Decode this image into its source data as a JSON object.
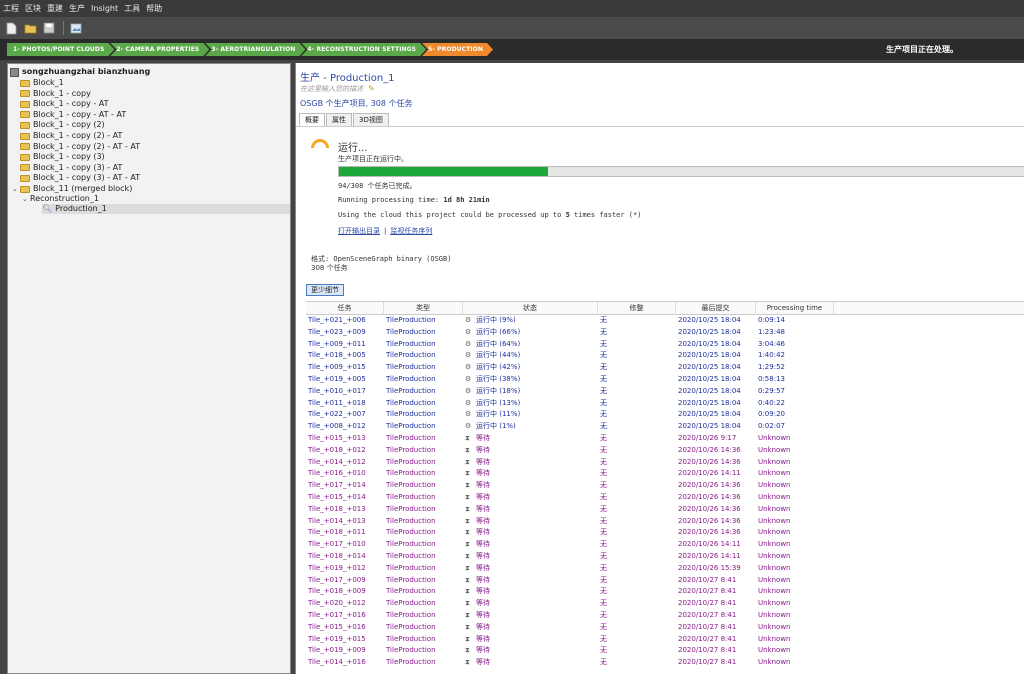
{
  "menu": [
    "工程",
    "区块",
    "重建",
    "生产",
    "Insight",
    "工具",
    "帮助"
  ],
  "toolbar": {
    "icons": [
      "new-file-icon",
      "open-folder-icon",
      "save-icon",
      "screenshot-icon"
    ]
  },
  "workflow": {
    "steps": [
      {
        "label": "1- PHOTOS/POINT CLOUDS",
        "color": "#5aa84a"
      },
      {
        "label": "2- CAMERA PROPERTIES",
        "color": "#5aa84a"
      },
      {
        "label": "3- AEROTRIANGULATION",
        "color": "#5aa84a"
      },
      {
        "label": "4- RECONSTRUCTION SETTINGS",
        "color": "#5aa84a"
      },
      {
        "label": "5- PRODUCTION",
        "color": "#ef8a2c"
      }
    ],
    "status": "生产项目正在处理。"
  },
  "tree": {
    "project": "songzhuangzhai bianzhuang",
    "blocks": [
      "Block_1",
      "Block_1 - copy",
      "Block_1 - copy - AT",
      "Block_1 - copy - AT - AT",
      "Block_1 - copy (2)",
      "Block_1 - copy (2) - AT",
      "Block_1 - copy (2) - AT - AT",
      "Block_1 - copy (3)",
      "Block_1 - copy (3) - AT",
      "Block_1 - copy (3) - AT - AT",
      "Block_11 (merged block)"
    ],
    "reconstruction": "Reconstruction_1",
    "production": "Production_1"
  },
  "main": {
    "title": "生产 - Production_1",
    "description_placeholder": "在这里输入您的描述",
    "subtitle": "OSGB 个生产项目, 308 个任务",
    "tabs": [
      "概要",
      "属性",
      "3D视图"
    ],
    "running_heading": "运行...",
    "running_sub": "生产项目正在运行中。",
    "progress": 0.3052,
    "done_text": "94/308 个任务已完成。",
    "runtime_label": "Running processing time:",
    "runtime_value": "1d 8h 21min",
    "cloud_text_prefix": "Using the cloud this project could be processed up to ",
    "cloud_text_bold": "5",
    "cloud_text_suffix": " times faster (*)",
    "link_open": "打开输出目录",
    "link_sep": "|",
    "link_monitor": "监视任务序列",
    "format_line": "格式: OpenSceneGraph binary (OSGB)",
    "task_count": "308 个任务",
    "less_button": "更少细节"
  },
  "table": {
    "headers": [
      "任务",
      "类型",
      "状态",
      "修整",
      "最后提交",
      "Processing time"
    ],
    "rows": [
      {
        "task": "Tile_+021_+006",
        "type": "TileProduction",
        "status": "运行中 (9%)",
        "state": "run",
        "warn": "无",
        "submitted": "2020/10/25 18:04",
        "time": "0:09:14"
      },
      {
        "task": "Tile_+023_+009",
        "type": "TileProduction",
        "status": "运行中 (66%)",
        "state": "run",
        "warn": "无",
        "submitted": "2020/10/25 18:04",
        "time": "1:23:48"
      },
      {
        "task": "Tile_+009_+011",
        "type": "TileProduction",
        "status": "运行中 (64%)",
        "state": "run",
        "warn": "无",
        "submitted": "2020/10/25 18:04",
        "time": "3:04:46"
      },
      {
        "task": "Tile_+018_+005",
        "type": "TileProduction",
        "status": "运行中 (44%)",
        "state": "run",
        "warn": "无",
        "submitted": "2020/10/25 18:04",
        "time": "1:40:42"
      },
      {
        "task": "Tile_+009_+015",
        "type": "TileProduction",
        "status": "运行中 (42%)",
        "state": "run",
        "warn": "无",
        "submitted": "2020/10/25 18:04",
        "time": "1:29:52"
      },
      {
        "task": "Tile_+019_+005",
        "type": "TileProduction",
        "status": "运行中 (38%)",
        "state": "run",
        "warn": "无",
        "submitted": "2020/10/25 18:04",
        "time": "0:58:13"
      },
      {
        "task": "Tile_+010_+017",
        "type": "TileProduction",
        "status": "运行中 (18%)",
        "state": "run",
        "warn": "无",
        "submitted": "2020/10/25 18:04",
        "time": "0:29:57"
      },
      {
        "task": "Tile_+011_+018",
        "type": "TileProduction",
        "status": "运行中 (13%)",
        "state": "run",
        "warn": "无",
        "submitted": "2020/10/25 18:04",
        "time": "0:40:22"
      },
      {
        "task": "Tile_+022_+007",
        "type": "TileProduction",
        "status": "运行中 (11%)",
        "state": "run",
        "warn": "无",
        "submitted": "2020/10/25 18:04",
        "time": "0:09:20"
      },
      {
        "task": "Tile_+008_+012",
        "type": "TileProduction",
        "status": "运行中 (1%)",
        "state": "run",
        "warn": "无",
        "submitted": "2020/10/25 18:04",
        "time": "0:02:07"
      },
      {
        "task": "Tile_+015_+013",
        "type": "TileProduction",
        "status": "等待",
        "state": "wait",
        "warn": "无",
        "submitted": "2020/10/26 9:17",
        "time": "Unknown"
      },
      {
        "task": "Tile_+018_+012",
        "type": "TileProduction",
        "status": "等待",
        "state": "wait",
        "warn": "无",
        "submitted": "2020/10/26 14:36",
        "time": "Unknown"
      },
      {
        "task": "Tile_+014_+012",
        "type": "TileProduction",
        "status": "等待",
        "state": "wait",
        "warn": "无",
        "submitted": "2020/10/26 14:36",
        "time": "Unknown"
      },
      {
        "task": "Tile_+016_+010",
        "type": "TileProduction",
        "status": "等待",
        "state": "wait",
        "warn": "无",
        "submitted": "2020/10/26 14:11",
        "time": "Unknown"
      },
      {
        "task": "Tile_+017_+014",
        "type": "TileProduction",
        "status": "等待",
        "state": "wait",
        "warn": "无",
        "submitted": "2020/10/26 14:36",
        "time": "Unknown"
      },
      {
        "task": "Tile_+015_+014",
        "type": "TileProduction",
        "status": "等待",
        "state": "wait",
        "warn": "无",
        "submitted": "2020/10/26 14:36",
        "time": "Unknown"
      },
      {
        "task": "Tile_+018_+013",
        "type": "TileProduction",
        "status": "等待",
        "state": "wait",
        "warn": "无",
        "submitted": "2020/10/26 14:36",
        "time": "Unknown"
      },
      {
        "task": "Tile_+014_+013",
        "type": "TileProduction",
        "status": "等待",
        "state": "wait",
        "warn": "无",
        "submitted": "2020/10/26 14:36",
        "time": "Unknown"
      },
      {
        "task": "Tile_+018_+011",
        "type": "TileProduction",
        "status": "等待",
        "state": "wait",
        "warn": "无",
        "submitted": "2020/10/26 14:36",
        "time": "Unknown"
      },
      {
        "task": "Tile_+017_+010",
        "type": "TileProduction",
        "status": "等待",
        "state": "wait",
        "warn": "无",
        "submitted": "2020/10/26 14:11",
        "time": "Unknown"
      },
      {
        "task": "Tile_+018_+014",
        "type": "TileProduction",
        "status": "等待",
        "state": "wait",
        "warn": "无",
        "submitted": "2020/10/26 14:11",
        "time": "Unknown"
      },
      {
        "task": "Tile_+019_+012",
        "type": "TileProduction",
        "status": "等待",
        "state": "wait",
        "warn": "无",
        "submitted": "2020/10/26 15:39",
        "time": "Unknown"
      },
      {
        "task": "Tile_+017_+009",
        "type": "TileProduction",
        "status": "等待",
        "state": "wait",
        "warn": "无",
        "submitted": "2020/10/27 8:41",
        "time": "Unknown"
      },
      {
        "task": "Tile_+018_+009",
        "type": "TileProduction",
        "status": "等待",
        "state": "wait",
        "warn": "无",
        "submitted": "2020/10/27 8:41",
        "time": "Unknown"
      },
      {
        "task": "Tile_+020_+012",
        "type": "TileProduction",
        "status": "等待",
        "state": "wait",
        "warn": "无",
        "submitted": "2020/10/27 8:41",
        "time": "Unknown"
      },
      {
        "task": "Tile_+017_+016",
        "type": "TileProduction",
        "status": "等待",
        "state": "wait",
        "warn": "无",
        "submitted": "2020/10/27 8:41",
        "time": "Unknown"
      },
      {
        "task": "Tile_+015_+016",
        "type": "TileProduction",
        "status": "等待",
        "state": "wait",
        "warn": "无",
        "submitted": "2020/10/27 8:41",
        "time": "Unknown"
      },
      {
        "task": "Tile_+019_+015",
        "type": "TileProduction",
        "status": "等待",
        "state": "wait",
        "warn": "无",
        "submitted": "2020/10/27 8:41",
        "time": "Unknown"
      },
      {
        "task": "Tile_+019_+009",
        "type": "TileProduction",
        "status": "等待",
        "state": "wait",
        "warn": "无",
        "submitted": "2020/10/27 8:41",
        "time": "Unknown"
      },
      {
        "task": "Tile_+014_+016",
        "type": "TileProduction",
        "status": "等待",
        "state": "wait",
        "warn": "无",
        "submitted": "2020/10/27 8:41",
        "time": "Unknown"
      }
    ]
  }
}
